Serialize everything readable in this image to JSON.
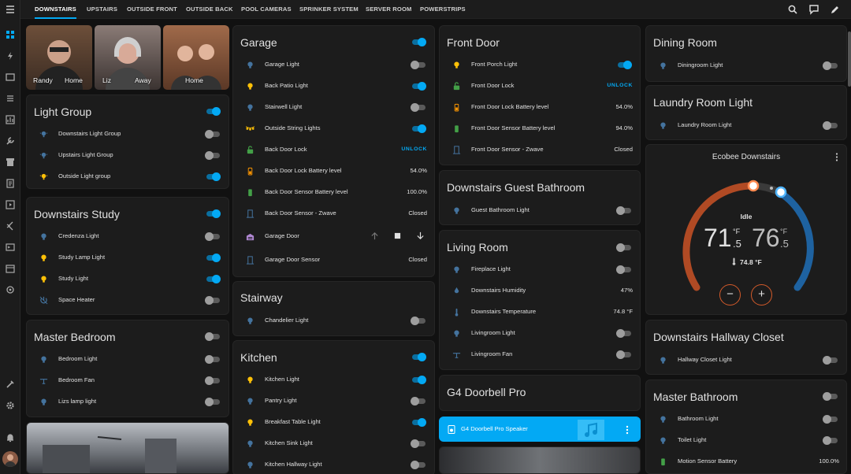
{
  "colors": {
    "accent": "#03a9f4",
    "bulb_on": "#ffc107",
    "bulb_off": "#44739e",
    "lock": "#43a047",
    "battery_mid": "#ff9800",
    "card": "#1c1c1c"
  },
  "tabs": [
    "DOWNSTAIRS",
    "UPSTAIRS",
    "OUTSIDE FRONT",
    "OUTSIDE BACK",
    "POOL CAMERAS",
    "SPRINKER SYSTEM",
    "SERVER ROOM",
    "POWERSTRIPS"
  ],
  "people": [
    {
      "name": "Randy",
      "state": "Home"
    },
    {
      "name": "Liz",
      "state": "Away"
    },
    {
      "name": "",
      "state": "Home"
    }
  ],
  "light_group": {
    "title": "Light Group",
    "items": [
      "Downstairs Light Group",
      "Upstairs Light Group",
      "Outside Light group"
    ]
  },
  "study": {
    "title": "Downstairs Study",
    "items": [
      "Credenza Light",
      "Study Lamp Light",
      "Study Light",
      "Space Heater"
    ]
  },
  "master": {
    "title": "Master Bedroom",
    "items": [
      "Bedroom Light",
      "Bedroom Fan",
      "Lizs lamp light"
    ]
  },
  "garage": {
    "title": "Garage",
    "items": [
      {
        "label": "Garage Light"
      },
      {
        "label": "Back Patio Light"
      },
      {
        "label": "Stairwell Light"
      },
      {
        "label": "Outside String Lights"
      },
      {
        "label": "Back Door Lock",
        "value": "UNLOCK"
      },
      {
        "label": "Back Door Lock Battery level",
        "value": "54.0%"
      },
      {
        "label": "Back Door Sensor Battery level",
        "value": "100.0%"
      },
      {
        "label": "Back Door Sensor - Zwave",
        "value": "Closed"
      },
      {
        "label": "Garage Door"
      },
      {
        "label": "Garage Door Sensor",
        "value": "Closed"
      }
    ]
  },
  "stairway": {
    "title": "Stairway",
    "items": [
      "Chandelier Light"
    ]
  },
  "kitchen": {
    "title": "Kitchen",
    "items": [
      "Kitchen Light",
      "Pantry Light",
      "Breakfast Table Light",
      "Kitchen Sink Light",
      "Kitchen Hallway Light"
    ]
  },
  "front": {
    "title": "Front Door",
    "items": [
      {
        "label": "Front Porch Light"
      },
      {
        "label": "Front Door Lock",
        "value": "UNLOCK"
      },
      {
        "label": "Front Door Lock Battery level",
        "value": "54.0%"
      },
      {
        "label": "Front Door Sensor Battery level",
        "value": "94.0%"
      },
      {
        "label": "Front Door Sensor - Zwave",
        "value": "Closed"
      }
    ]
  },
  "guest": {
    "title": "Downstairs Guest Bathroom",
    "items": [
      "Guest Bathroom Light"
    ]
  },
  "living": {
    "title": "Living Room",
    "items": [
      {
        "label": "Fireplace Light"
      },
      {
        "label": "Downstairs Humidity",
        "value": "47%"
      },
      {
        "label": "Downstairs Temperature",
        "value": "74.8 °F"
      },
      {
        "label": "Livingroom Light"
      },
      {
        "label": "Livingroom Fan"
      }
    ]
  },
  "doorbell": {
    "title": "G4 Doorbell Pro",
    "speaker": "G4 Doorbell Pro Speaker"
  },
  "dining": {
    "title": "Dining Room",
    "items": [
      "Diningroom Light"
    ]
  },
  "laundry": {
    "title": "Laundry Room Light",
    "items": [
      "Laundry Room Light"
    ]
  },
  "ecobee": {
    "title": "Ecobee Downstairs",
    "mode": "Idle",
    "low_int": "71",
    "low_dec": ".5",
    "high_int": "76",
    "high_dec": ".5",
    "unit": "°F",
    "current": "74.8 °F",
    "minus": "−",
    "plus": "+"
  },
  "closet": {
    "title": "Downstairs Hallway Closet",
    "items": [
      "Hallway Closet Light"
    ]
  },
  "mbath": {
    "title": "Master Bathroom",
    "items": [
      {
        "label": "Bathroom Light"
      },
      {
        "label": "Toilet Light"
      },
      {
        "label": "Motion Sensor Battery",
        "value": "100.0%"
      }
    ]
  }
}
